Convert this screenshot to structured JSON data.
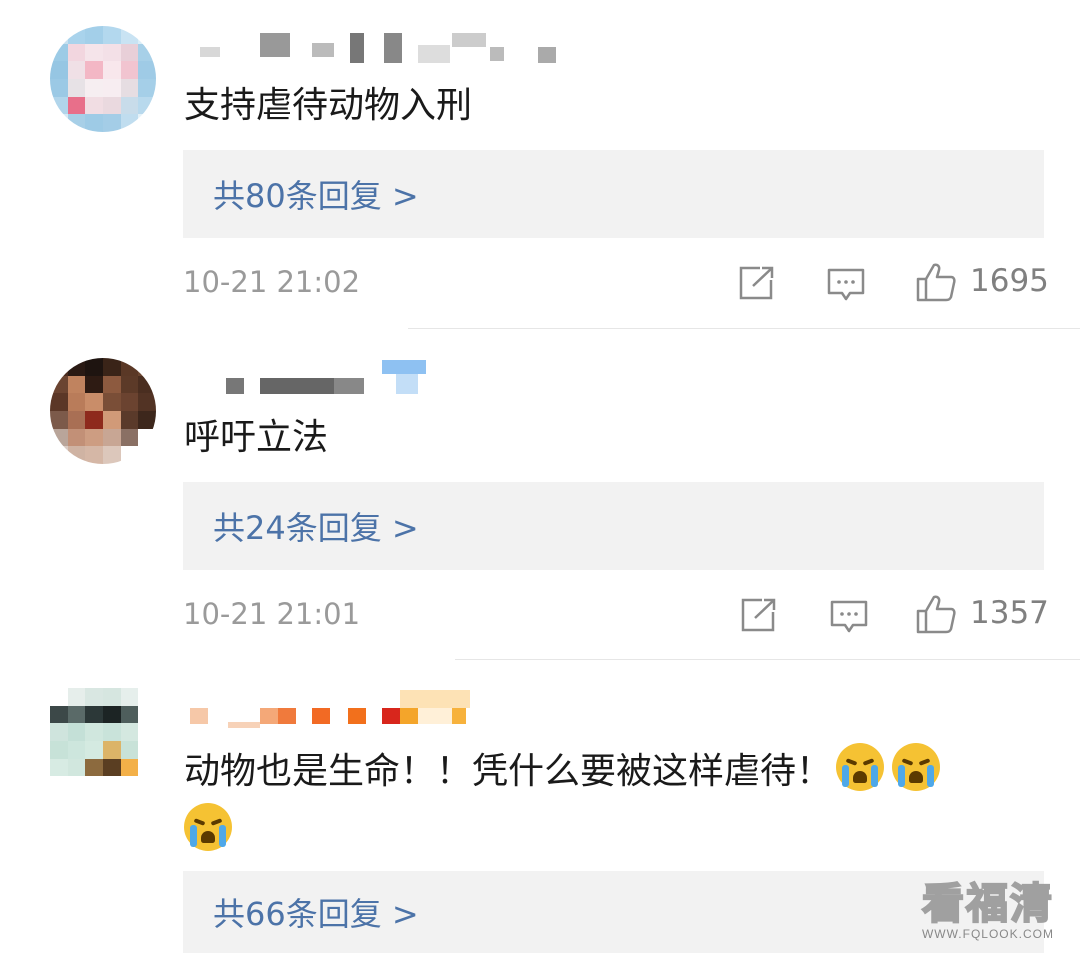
{
  "comments": [
    {
      "text": "支持虐待动物入刑",
      "replies_label": "共80条回复 >",
      "time": "10-21 21:02",
      "likes": "1695"
    },
    {
      "text": "呼吁立法",
      "replies_label": "共24条回复 >",
      "time": "10-21 21:01",
      "likes": "1357"
    },
    {
      "text": "动物也是生命！！凭什么要被这样虐待！",
      "replies_label": "共66条回复 >"
    }
  ],
  "icons": {
    "share": "share-icon",
    "comment": "comment-icon",
    "like": "thumbs-up-icon",
    "cry": "crying-face-emoji"
  },
  "colors": {
    "link": "#4c73a8",
    "reply_bg": "#f2f2f2",
    "meta": "#9a9a9a"
  },
  "watermark": {
    "main": "看福清",
    "sub": "WWW.FQLOOK.COM"
  }
}
